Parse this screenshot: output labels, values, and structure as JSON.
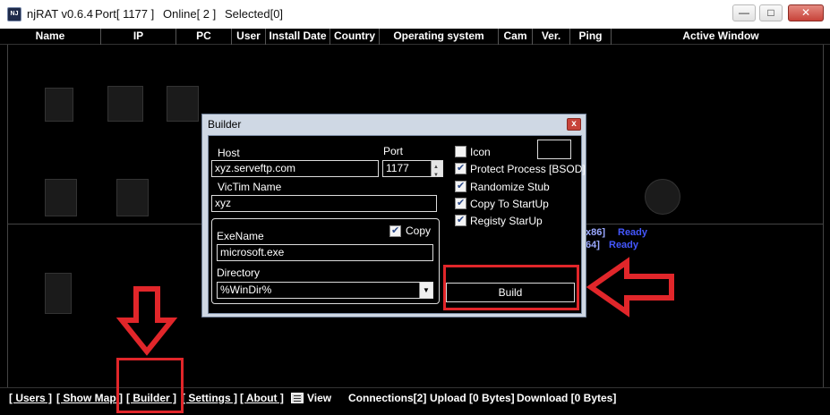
{
  "window": {
    "app": "njRAT v0.6.4",
    "port": "Port[ 1177 ]",
    "online": "Online[ 2 ]",
    "selected": "Selected[0]",
    "minimize": "—",
    "maximize": "□",
    "close": "✕"
  },
  "columns": [
    "Name",
    "IP",
    "PC",
    "User",
    "Install Date",
    "Country",
    "Operating system",
    "Cam",
    "Ver.",
    "Ping",
    "Active Window"
  ],
  "background_text": {
    "row1a": "x86]",
    "row1b": "Ready",
    "row2a": "64]",
    "row2b": "Ready"
  },
  "builder": {
    "title": "Builder",
    "close": "x",
    "host_label": "Host",
    "host_value": "xyz.serveftp.com",
    "port_label": "Port",
    "port_value": "1177",
    "victim_label": "VicTim Name",
    "victim_value": "xyz",
    "exename_label": "ExeName",
    "exename_value": "microsoft.exe",
    "copy_label": "Copy",
    "copy_checked": true,
    "directory_label": "Directory",
    "directory_value": "%WinDir%",
    "options": [
      {
        "label": "Icon",
        "checked": false
      },
      {
        "label": "Protect Process [BSOD]",
        "checked": true
      },
      {
        "label": "Randomize Stub",
        "checked": true
      },
      {
        "label": "Copy To StartUp",
        "checked": true
      },
      {
        "label": "Registy StarUp",
        "checked": true
      }
    ],
    "build_label": "Build"
  },
  "statusbar": {
    "users": "[ Users ]",
    "showmap": "[ Show Map ]",
    "builder": "[ Builder ]",
    "settings": "[ Settings ]",
    "about": "[ About ]",
    "view": "View",
    "connections": "Connections[2]",
    "upload": "Upload [0 Bytes]",
    "download": "Download [0 Bytes]"
  },
  "annotation_color": "#e1262a"
}
